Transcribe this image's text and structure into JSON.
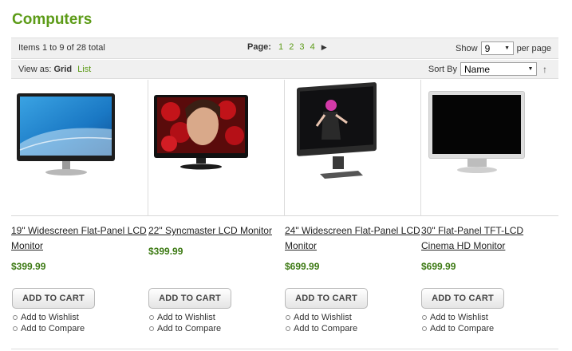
{
  "category": {
    "title": "Computers"
  },
  "pager": {
    "amount": "Items 1 to 9 of 28 total",
    "page_label": "Page:",
    "pages": [
      "1",
      "2",
      "3",
      "4"
    ],
    "next_icon": "next-arrow",
    "show_label": "Show",
    "limit_value": "9",
    "per_page_label": "per page"
  },
  "toolbar": {
    "view_as_label": "View as:",
    "grid_label": "Grid",
    "list_label": "List",
    "sort_by_label": "Sort By",
    "sort_value": "Name",
    "sort_dir_icon": "arrow-up"
  },
  "products": [
    {
      "name": "19\" Widescreen Flat-Panel LCD Monitor",
      "price": "$399.99",
      "add_to_cart": "ADD TO CART",
      "wishlist": "Add to Wishlist",
      "compare": "Add to Compare"
    },
    {
      "name": "22\" Syncmaster LCD Monitor",
      "price": "$399.99",
      "add_to_cart": "ADD TO CART",
      "wishlist": "Add to Wishlist",
      "compare": "Add to Compare"
    },
    {
      "name": "24\" Widescreen Flat-Panel LCD Monitor",
      "price": "$699.99",
      "add_to_cart": "ADD TO CART",
      "wishlist": "Add to Wishlist",
      "compare": "Add to Compare"
    },
    {
      "name": "30\" Flat-Panel TFT-LCD Cinema HD Monitor",
      "price": "$699.99",
      "add_to_cart": "ADD TO CART",
      "wishlist": "Add to Wishlist",
      "compare": "Add to Compare"
    }
  ],
  "colors": {
    "accent": "#5c9b17",
    "price": "#3d7a14",
    "toolbar_bg": "#f0f0f0"
  }
}
